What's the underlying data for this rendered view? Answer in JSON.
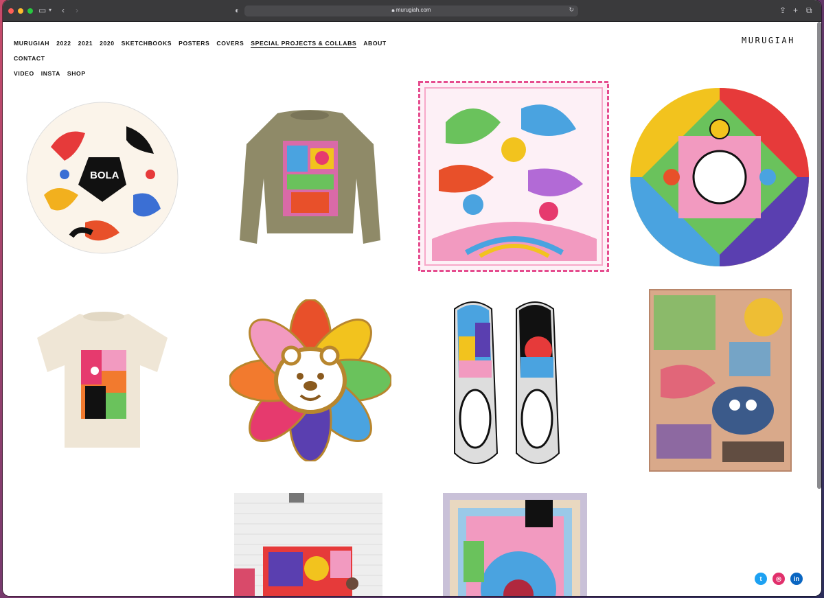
{
  "browser": {
    "url": "murugiah.com"
  },
  "nav": {
    "row1": [
      "MURUGIAH",
      "2022",
      "2021",
      "2020",
      "SKETCHBOOKS",
      "POSTERS",
      "COVERS",
      "SPECIAL PROJECTS & COLLABS",
      "ABOUT",
      "CONTACT"
    ],
    "row2": [
      "VIDEO",
      "INSTA",
      "SHOP"
    ],
    "active": "SPECIAL PROJECTS & COLLABS"
  },
  "logo": "MURUGIAH",
  "gallery": {
    "items": [
      {
        "name": "football",
        "text": "BOLA"
      },
      {
        "name": "sweatshirt"
      },
      {
        "name": "scarf-print"
      },
      {
        "name": "circular-artwork"
      },
      {
        "name": "tshirt"
      },
      {
        "name": "lion-flower-pin"
      },
      {
        "name": "slip-on-shoes"
      },
      {
        "name": "woven-blanket-1"
      },
      {
        "name": "rug-wall-photo"
      },
      {
        "name": "woven-blanket-2"
      }
    ]
  },
  "social": [
    "twitter",
    "instagram",
    "linkedin"
  ],
  "colors": {
    "titlebar": "#3a3a3c",
    "twitter": "#1da1f2",
    "instagram": "#e1306c",
    "linkedin": "#0a66c2"
  }
}
